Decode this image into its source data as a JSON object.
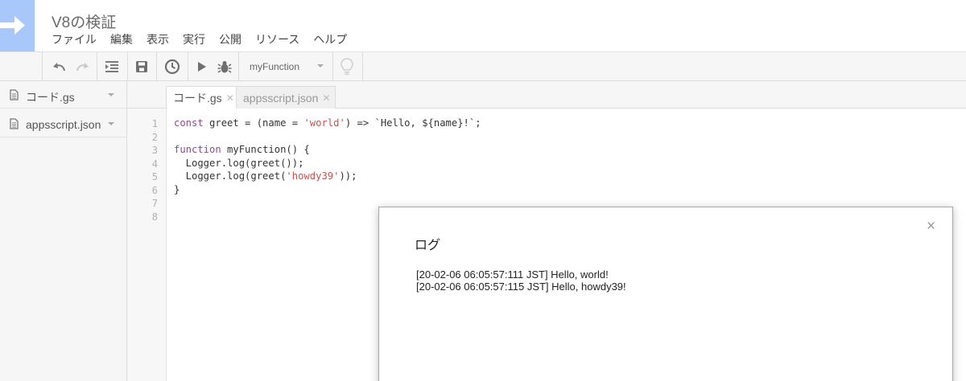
{
  "app": {
    "title": "V8の検証",
    "logo_icon": "arrow-right-icon",
    "brand_color": "#a8c7fa"
  },
  "menu": [
    "ファイル",
    "編集",
    "表示",
    "実行",
    "公開",
    "リソース",
    "ヘルプ"
  ],
  "toolbar": {
    "icons": [
      "undo-icon",
      "redo-icon",
      "indent-icon",
      "save-icon",
      "trigger-clock-icon",
      "run-icon",
      "debug-icon",
      "lightbulb-icon"
    ],
    "function_select": "myFunction"
  },
  "sidebar": {
    "files": [
      {
        "name": "コード.gs",
        "icon": "file-icon"
      },
      {
        "name": "appsscript.json",
        "icon": "file-icon"
      }
    ]
  },
  "tabs": [
    {
      "label": "コード.gs",
      "active": true
    },
    {
      "label": "appsscript.json",
      "active": false
    }
  ],
  "editor": {
    "line_numbers": [
      "1",
      "2",
      "3",
      "4",
      "5",
      "6",
      "7",
      "8"
    ],
    "lines": [
      "const greet = (name = 'world') => `Hello, ${name}!`;",
      "",
      "function myFunction() {",
      "  Logger.log(greet());",
      "  Logger.log(greet('howdy39'));",
      "}",
      "",
      ""
    ],
    "keyword_color": "#8a4b8e",
    "string_color": "#c4544f"
  },
  "log_dialog": {
    "title": "ログ",
    "close_label": "×",
    "lines": [
      "[20-02-06 06:05:57:111 JST] Hello, world!",
      "[20-02-06 06:05:57:115 JST] Hello, howdy39!"
    ]
  }
}
